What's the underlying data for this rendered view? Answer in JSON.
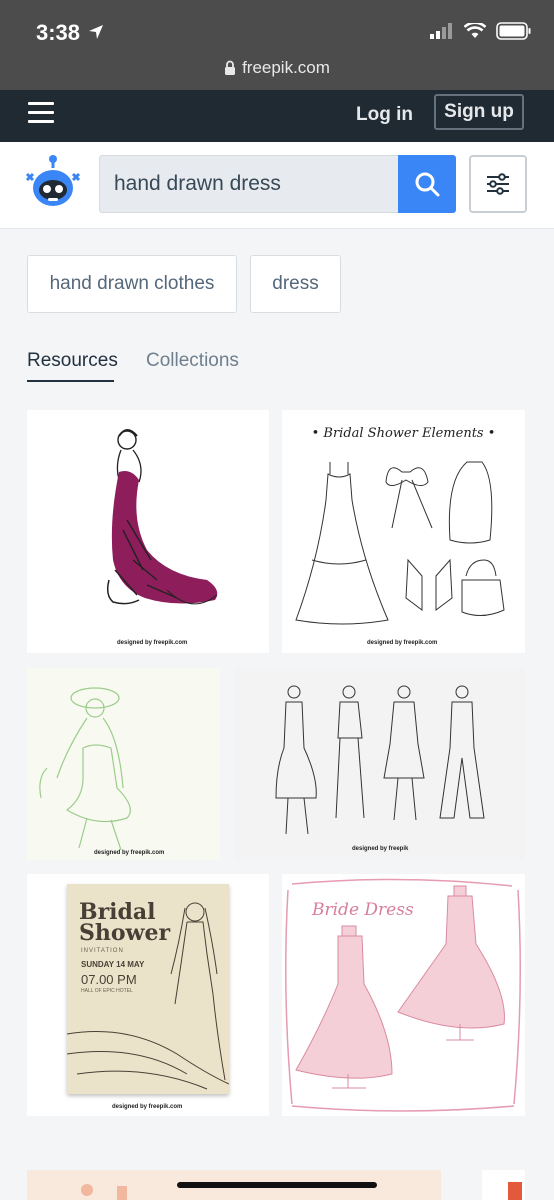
{
  "status_bar": {
    "time": "3:38",
    "url": "freepik.com"
  },
  "nav": {
    "login_label": "Log in",
    "signup_label": "Sign up"
  },
  "search": {
    "value": "hand drawn dress"
  },
  "tags": [
    "hand drawn clothes",
    "dress"
  ],
  "tabs": [
    "Resources",
    "Collections"
  ],
  "cards": [
    {
      "title": "",
      "credit": "designed by freepik.com"
    },
    {
      "title": "• Bridal Shower Elements •",
      "credit": "designed by freepik.com"
    },
    {
      "title": "",
      "credit": "designed by freepik.com"
    },
    {
      "title": "",
      "credit": "designed by freepik"
    },
    {
      "title": "Bridal Shower",
      "subtitle": "INVITATION",
      "date": "SUNDAY 14 MAY",
      "hour": "07.00 PM",
      "place": "HALL OF EPIC HOTEL",
      "credit": "designed by freepik.com"
    },
    {
      "title": "Bride Dress",
      "credit": ""
    }
  ],
  "colors": {
    "accent": "#3b86f7",
    "nav_bg": "#1f2a33",
    "status_bg": "#4c4c4c",
    "dress_magenta": "#8e1d5b"
  }
}
